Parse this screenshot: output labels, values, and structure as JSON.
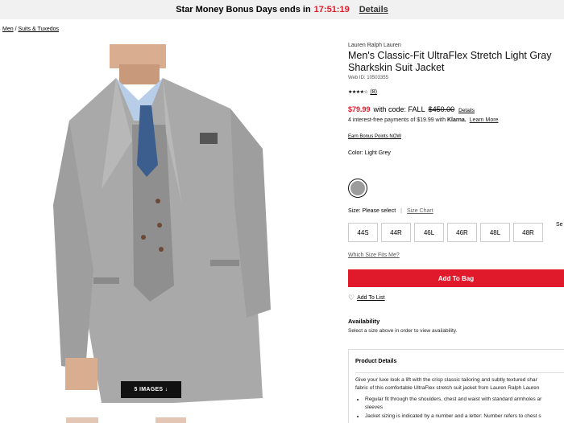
{
  "promo": {
    "text": "Star Money Bonus Days ends in",
    "timer": "17:51:19",
    "details": "Details"
  },
  "breadcrumb": {
    "first": "Men",
    "sep": " / ",
    "second": "Suits & Tuxedos"
  },
  "gallery": {
    "images_button": "5 IMAGES ↓"
  },
  "product": {
    "brand": "Lauren Ralph Lauren",
    "title": "Men's Classic-Fit UltraFlex Stretch Light Gray Sharkskin Suit Jacket",
    "web_id": "Web ID: 10503355",
    "stars": "★★★★☆",
    "rating_count": "(8)",
    "sale_price": "$79.99",
    "code_text": "with code: FALL",
    "original_price": "$450.00",
    "price_details": "Details",
    "installments_prefix": "4 interest-free payments of $19.99 with",
    "installments_brand": "Klarna.",
    "installments_link": "Learn More",
    "bonus_link": "Earn Bonus Points NOW",
    "color_label": "Color: Light Grey",
    "swatch_color": "#9c9c9c",
    "size_label": "Size: Please select",
    "size_chart": "Size Chart",
    "sizes": [
      "44S",
      "44R",
      "46L",
      "46R",
      "48L",
      "48R"
    ],
    "size_cut": "Se",
    "fit_link": "Which Size Fits Me?",
    "add_to_bag": "Add To Bag",
    "add_to_list": "Add To List",
    "availability_title": "Availability",
    "availability_text": "Select a size above in order to view availability.",
    "details_title": "Product Details",
    "details_p1": "Give your luxe look a lift with the crisp classic tailoring and subtly textured shar",
    "details_p2": "fabric of this comfortable UltraFlex stretch suit jacket from Lauren Ralph Lauren",
    "details_b1a": "Regular fit through the shoulders, chest and waist with standard armholes ar",
    "details_b1b": "sleeves",
    "details_b2": "Jacket sizing is indicated by a number and a letter: Number refers to chest s"
  },
  "colors": {
    "accent": "#e11a2b",
    "promo_bg": "#f1f1f1"
  }
}
